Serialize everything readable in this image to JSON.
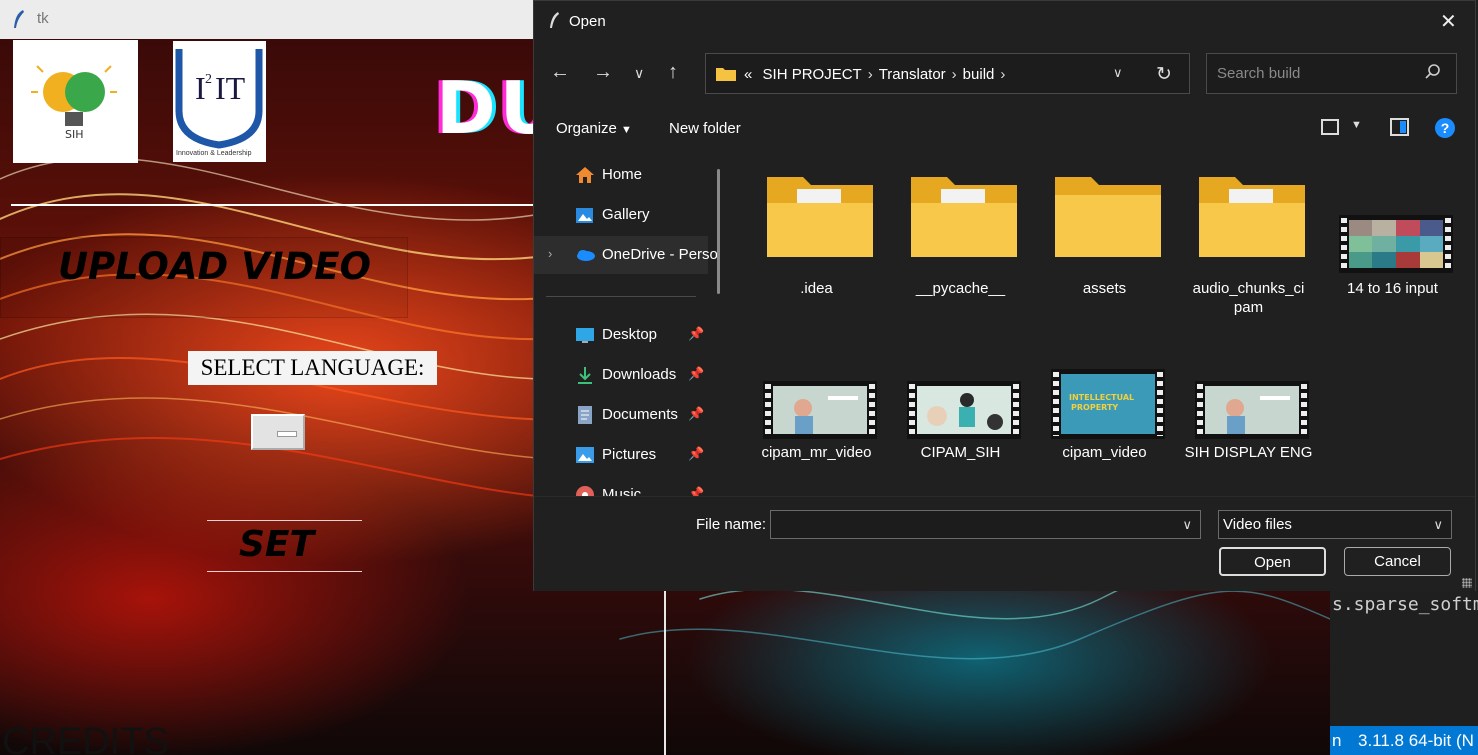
{
  "vscode": {
    "code_line": "s.sparse_softm",
    "status_n": "n",
    "status_version": "3.11.8 64-bit (N"
  },
  "tk": {
    "title": "tk",
    "logo_sih_text": "SIH",
    "logo_i2it_text": "I²IT",
    "logo_i2it_tagline": "Innovation & Leadership",
    "header_partial": "DU",
    "upload_label": "UPLOAD VIDEO",
    "select_language_label": "SELECT LANGUAGE:",
    "set_label": "SET",
    "credits_label": "CREDITS"
  },
  "dialog": {
    "title": "Open",
    "address": {
      "overflow": "«",
      "crumbs": [
        "SIH PROJECT",
        "Translator",
        "build"
      ]
    },
    "search_placeholder": "Search build",
    "toolbar": {
      "organize": "Organize",
      "new_folder": "New folder"
    },
    "nav": [
      {
        "label": "Home",
        "icon": "home-icon"
      },
      {
        "label": "Gallery",
        "icon": "gallery-icon"
      },
      {
        "label": "OneDrive - Perso",
        "icon": "onedrive-icon"
      },
      {
        "label": "Desktop",
        "icon": "desktop-icon"
      },
      {
        "label": "Downloads",
        "icon": "downloads-icon"
      },
      {
        "label": "Documents",
        "icon": "documents-icon"
      },
      {
        "label": "Pictures",
        "icon": "pictures-icon"
      },
      {
        "label": "Music",
        "icon": "music-icon"
      }
    ],
    "files": [
      {
        "name": ".idea",
        "type": "folder"
      },
      {
        "name": "__pycache__",
        "type": "folder"
      },
      {
        "name": "assets",
        "type": "folder"
      },
      {
        "name": "audio_chunks_cipam",
        "name_line1": "audio_chunks_ci",
        "name_line2": "pam",
        "type": "folder"
      },
      {
        "name": "14 to 16 input",
        "type": "video"
      },
      {
        "name": "cipam_mr_video",
        "type": "video"
      },
      {
        "name": "CIPAM_SIH",
        "type": "video"
      },
      {
        "name": "cipam_video",
        "type": "video",
        "thumb_text": "INTELLECTUAL PROPERTY"
      },
      {
        "name": "SIH DISPLAY ENG",
        "type": "video"
      }
    ],
    "file_name_label": "File name:",
    "file_name_value": "",
    "file_type": "Video files",
    "open_button": "Open",
    "cancel_button": "Cancel"
  },
  "colors": {
    "accent": "#1a8cff",
    "dialog_bg": "#202020",
    "vscode_status": "#0078d4"
  }
}
